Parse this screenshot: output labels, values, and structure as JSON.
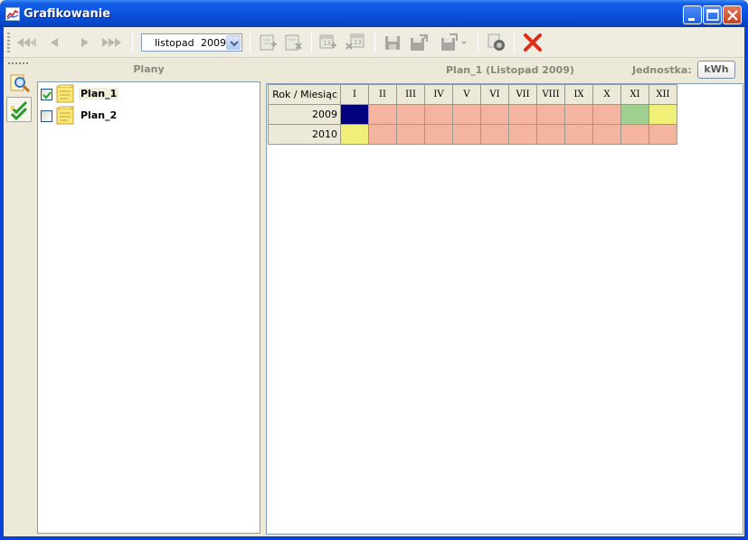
{
  "window": {
    "title": "Grafikowanie"
  },
  "toolbar": {
    "month": "listopad",
    "year": "2009"
  },
  "left_panel": {
    "header": "Plany",
    "plans": [
      {
        "label": "Plan_1",
        "checked": true,
        "selected": true
      },
      {
        "label": "Plan_2",
        "checked": false,
        "selected": false
      }
    ]
  },
  "right_panel": {
    "title": "Plan_1 (Listopad 2009)",
    "unit_label": "Jednostka:",
    "unit_value": "kWh"
  },
  "grid": {
    "corner": "Rok / Miesiąc",
    "months": [
      "I",
      "II",
      "III",
      "IV",
      "V",
      "VI",
      "VII",
      "VIII",
      "IX",
      "X",
      "XI",
      "XII"
    ],
    "rows": [
      {
        "year": "2009",
        "states": [
          "selected",
          "pink",
          "pink",
          "pink",
          "pink",
          "pink",
          "pink",
          "pink",
          "pink",
          "pink",
          "green",
          "yellow"
        ]
      },
      {
        "year": "2010",
        "states": [
          "yellow",
          "pink",
          "pink",
          "pink",
          "pink",
          "pink",
          "pink",
          "pink",
          "pink",
          "pink",
          "pink",
          "pink"
        ]
      }
    ]
  },
  "colors": {
    "selected": "#00007f",
    "pink": "#f4b4a0",
    "green": "#a0d090",
    "yellow": "#f0f078"
  }
}
